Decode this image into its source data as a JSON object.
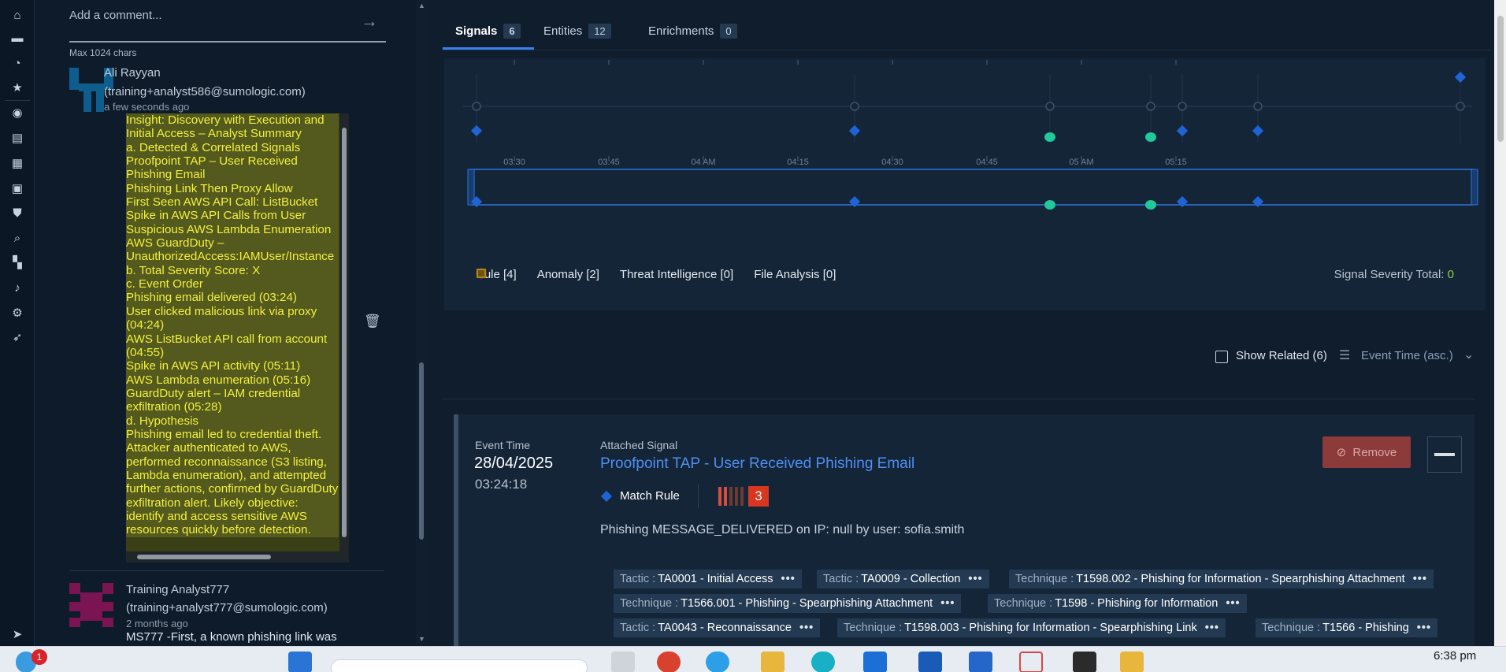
{
  "nav": {
    "icons": [
      "home-icon",
      "folder-icon",
      "dashboard-icon",
      "star-icon",
      "bot-icon",
      "document-icon",
      "grid-icon",
      "image-icon",
      "shield-icon",
      "search-icon",
      "apps-icon",
      "bell-icon",
      "settings-icon",
      "rocket-icon",
      "send-icon"
    ]
  },
  "comments": {
    "placeholder": "Add a comment...",
    "max_chars": "Max 1024 chars",
    "items": [
      {
        "name": "Ali Rayyan",
        "email": "(training+analyst586@sumologic.com)",
        "time": "a few seconds ago",
        "body": "Insight: Discovery with Execution and Initial Access – Analyst Summary\na. Detected & Correlated Signals\nProofpoint TAP – User Received Phishing Email\nPhishing Link Then Proxy Allow\nFirst Seen AWS API Call: ListBucket\nSpike in AWS API Calls from User\nSuspicious AWS Lambda Enumeration\nAWS GuardDuty – UnauthorizedAccess:IAMUser/Instance\nb. Total Severity Score: X\nc. Event Order\nPhishing email delivered (03:24)\nUser clicked malicious link via proxy (04:24)\nAWS ListBucket API call from account (04:55)\nSpike in AWS API activity (05:11)\nAWS Lambda enumeration (05:16)\nGuardDuty alert – IAM credential exfiltration (05:28)\nd. Hypothesis\nPhishing email led to credential theft. Attacker authenticated to AWS, performed reconnaissance (S3 listing, Lambda enumeration), and attempted further actions, confirmed by GuardDuty exfiltration alert. Likely objective: identify and access sensitive AWS resources quickly before detection."
      },
      {
        "name": "Training Analyst777",
        "email": "(training+analyst777@sumologic.com)",
        "time": "2 months ago",
        "body": "MS777 -First, a known phishing link was"
      }
    ]
  },
  "tabs": [
    {
      "label": "Signals",
      "count": "6",
      "active": true
    },
    {
      "label": "Entities",
      "count": "12",
      "active": false
    },
    {
      "label": "Enrichments",
      "count": "0",
      "active": false
    }
  ],
  "chart_data": {
    "type": "scatter",
    "x_ticks": [
      "03:30",
      "03:45",
      "04 AM",
      "04:15",
      "04:30",
      "04:45",
      "05 AM",
      "05:15"
    ],
    "series": [
      {
        "name": "Rule [4]",
        "color": "#1f64d6",
        "shape": "diamond",
        "points": [
          "03:24",
          "04:24",
          "05:16",
          "05:28"
        ]
      },
      {
        "name": "Anomaly [2]",
        "color": "#20c997",
        "shape": "leaf",
        "points": [
          "04:55",
          "05:11"
        ]
      },
      {
        "name": "Threat Intelligence [0]",
        "color": "#8a2be2",
        "shape": "circle",
        "points": []
      },
      {
        "name": "File Analysis [0]",
        "color": "#b8860b",
        "shape": "square",
        "points": []
      }
    ]
  },
  "severity_total": {
    "label": "Signal Severity Total:",
    "value": "0"
  },
  "show_related": "Show Related (6)",
  "sort_label": "Event Time (asc.)",
  "signal": {
    "event_time_label": "Event Time",
    "date": "28/04/2025",
    "time": "03:24:18",
    "attached_label": "Attached Signal",
    "title": "Proofpoint TAP - User Received Phishing Email",
    "match_rule": "Match Rule",
    "severity": "3",
    "description": "Phishing MESSAGE_DELIVERED on IP: null by user: sofia.smith",
    "remove_label": "Remove",
    "tags": [
      {
        "k": "Tactic :",
        "v": "TA0001 - Initial Access"
      },
      {
        "k": "Tactic :",
        "v": "TA0009 - Collection"
      },
      {
        "k": "Technique :",
        "v": "T1598.002 - Phishing for Information - Spearphishing Attachment"
      },
      {
        "k": "Technique :",
        "v": "T1566.001 - Phishing - Spearphishing Attachment"
      },
      {
        "k": "Technique :",
        "v": "T1598 - Phishing for Information"
      },
      {
        "k": "Tactic :",
        "v": "TA0043 - Reconnaissance"
      },
      {
        "k": "Technique :",
        "v": "T1598.003 - Phishing for Information - Spearphishing Link"
      },
      {
        "k": "Technique :",
        "v": "T1566 - Phishing"
      }
    ]
  },
  "taskbar": {
    "notification_count": "1",
    "clock": "6:38 pm"
  }
}
